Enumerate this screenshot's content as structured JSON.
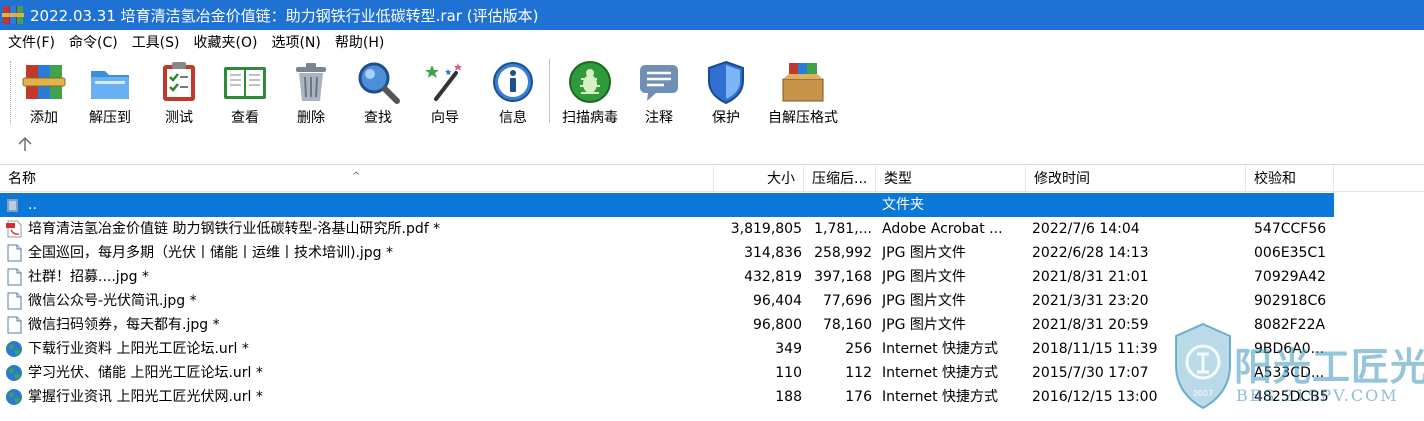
{
  "window": {
    "title": "2022.03.31 培育清洁氢冶金价值链：助力钢铁行业低碳转型.rar (评估版本)",
    "accent": "#1f72d3"
  },
  "menu": [
    "文件(F)",
    "命令(C)",
    "工具(S)",
    "收藏夹(O)",
    "选项(N)",
    "帮助(H)"
  ],
  "toolbar": [
    {
      "label": "添加",
      "icon": "add-archive-icon"
    },
    {
      "label": "解压到",
      "icon": "extract-to-folder-icon"
    },
    {
      "label": "测试",
      "icon": "test-clipboard-icon"
    },
    {
      "label": "查看",
      "icon": "view-book-icon"
    },
    {
      "label": "删除",
      "icon": "delete-trash-icon"
    },
    {
      "label": "查找",
      "icon": "find-magnifier-icon"
    },
    {
      "label": "向导",
      "icon": "wizard-wand-icon"
    },
    {
      "label": "信息",
      "icon": "info-icon"
    },
    {
      "label": "扫描病毒",
      "icon": "virus-scan-icon"
    },
    {
      "label": "注释",
      "icon": "comment-icon"
    },
    {
      "label": "保护",
      "icon": "protect-shield-icon"
    },
    {
      "label": "自解压格式",
      "icon": "sfx-box-icon"
    }
  ],
  "columns": {
    "name": "名称",
    "size": "大小",
    "packed": "压缩后...",
    "type": "类型",
    "modified": "修改时间",
    "crc": "校验和"
  },
  "parent_row": {
    "name": "..",
    "type": "文件夹"
  },
  "files": [
    {
      "name": "培育清洁氢冶金价值链 助力钢铁行业低碳转型-洛基山研究所.pdf *",
      "size": "3,819,805",
      "packed": "1,781,...",
      "type": "Adobe Acrobat ...",
      "modified": "2022/7/6 14:04",
      "crc": "547CCF56",
      "icon": "pdf-file-icon"
    },
    {
      "name": "全国巡回，每月多期（光伏丨储能丨运维丨技术培训).jpg *",
      "size": "314,836",
      "packed": "258,992",
      "type": "JPG 图片文件",
      "modified": "2022/6/28 14:13",
      "crc": "006E35C1",
      "icon": "image-file-icon"
    },
    {
      "name": "社群！招募....jpg *",
      "size": "432,819",
      "packed": "397,168",
      "type": "JPG 图片文件",
      "modified": "2021/8/31 21:01",
      "crc": "70929A42",
      "icon": "image-file-icon"
    },
    {
      "name": "微信公众号-光伏简讯.jpg *",
      "size": "96,404",
      "packed": "77,696",
      "type": "JPG 图片文件",
      "modified": "2021/3/31 23:20",
      "crc": "902918C6",
      "icon": "image-file-icon"
    },
    {
      "name": "微信扫码领券，每天都有.jpg *",
      "size": "96,800",
      "packed": "78,160",
      "type": "JPG 图片文件",
      "modified": "2021/8/31 20:59",
      "crc": "8082F22A",
      "icon": "image-file-icon"
    },
    {
      "name": "下载行业资料 上阳光工匠论坛.url *",
      "size": "349",
      "packed": "256",
      "type": "Internet 快捷方式",
      "modified": "2018/11/15 11:39",
      "crc": "9BD6A0...",
      "icon": "internet-shortcut-icon"
    },
    {
      "name": "学习光伏、储能 上阳光工匠论坛.url *",
      "size": "110",
      "packed": "112",
      "type": "Internet 快捷方式",
      "modified": "2015/7/30 17:07",
      "crc": "A533CD...",
      "icon": "internet-shortcut-icon"
    },
    {
      "name": "掌握行业资讯 上阳光工匠光伏网.url *",
      "size": "188",
      "packed": "176",
      "type": "Internet 快捷方式",
      "modified": "2016/12/15 13:00",
      "crc": "4825DCB5",
      "icon": "internet-shortcut-icon"
    }
  ],
  "watermark": {
    "text": "阳光工匠光伏论坛",
    "sub": "BBS.21SPV.COM",
    "year": "2007"
  },
  "colors": {
    "selection": "#0b78d7",
    "header_border": "#e5e5e5"
  }
}
